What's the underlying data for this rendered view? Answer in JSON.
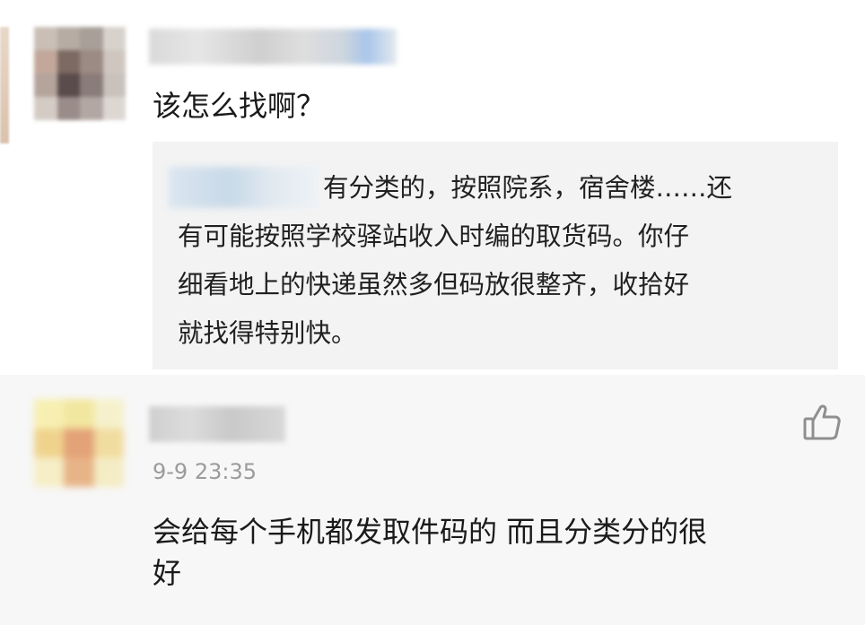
{
  "top_comment": {
    "text": "该怎么找啊？",
    "reply": {
      "lines": [
        "有分类的，按照院系，宿舍楼……还",
        "有可能按照学校驿站收入时编的取货码。你仔",
        "细看地上的快递虽然多但码放很整齐，收拾好",
        "就找得特别快。"
      ]
    }
  },
  "bottom_comment": {
    "timestamp": "9-9 23:35",
    "text_lines": [
      "会给每个手机都发取件码的 而且分类分的很",
      "好"
    ]
  },
  "icons": {
    "like": "thumbs-up-icon"
  },
  "colors": {
    "page_bg": "#ffffff",
    "second_comment_bg": "#f7f7f7",
    "quote_bg": "#f3f3f3",
    "meta_text": "#9b9b9b"
  }
}
